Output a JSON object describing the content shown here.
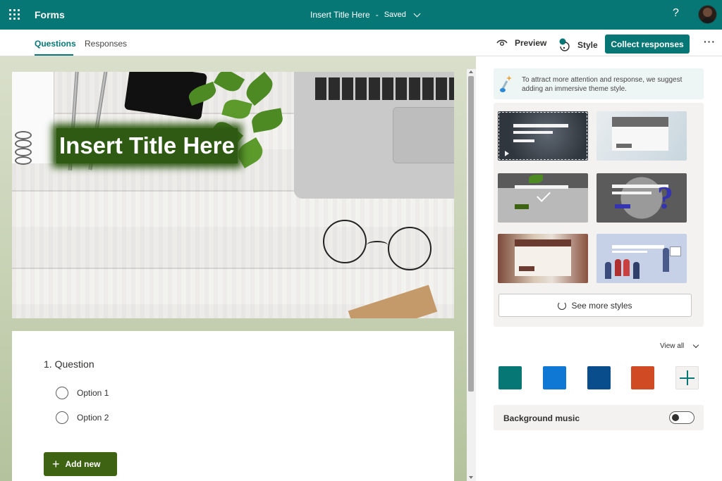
{
  "topbar": {
    "app_name": "Forms",
    "doc_title": "Insert Title Here",
    "separator": "-",
    "save_status": "Saved",
    "help_glyph": "?",
    "icons": [
      "waffle-icon",
      "chevron-down-icon",
      "help-icon",
      "avatar"
    ]
  },
  "subbar": {
    "tabs": [
      {
        "label": "Questions",
        "active": true
      },
      {
        "label": "Responses",
        "active": false
      }
    ],
    "preview_label": "Preview",
    "style_label": "Style",
    "collect_label": "Collect responses",
    "more_glyph": "···"
  },
  "form": {
    "banner_title": "Insert Title Here",
    "question": {
      "title": "1. Question",
      "options": [
        "Option 1",
        "Option 2"
      ]
    },
    "add_new_label": "Add new"
  },
  "style_panel": {
    "tip": "To attract more attention and response, we suggest adding an immersive theme style.",
    "see_more_label": "See more styles",
    "view_all_label": "View all",
    "theme_colors": [
      "#077776",
      "#0f78d4",
      "#0a4d8c",
      "#d04b24"
    ],
    "background_music_label": "Background music",
    "background_music_on": false
  },
  "colors": {
    "brand": "#077776",
    "add_new_button": "#3d6313",
    "title_highlight": "#2f5a14"
  }
}
